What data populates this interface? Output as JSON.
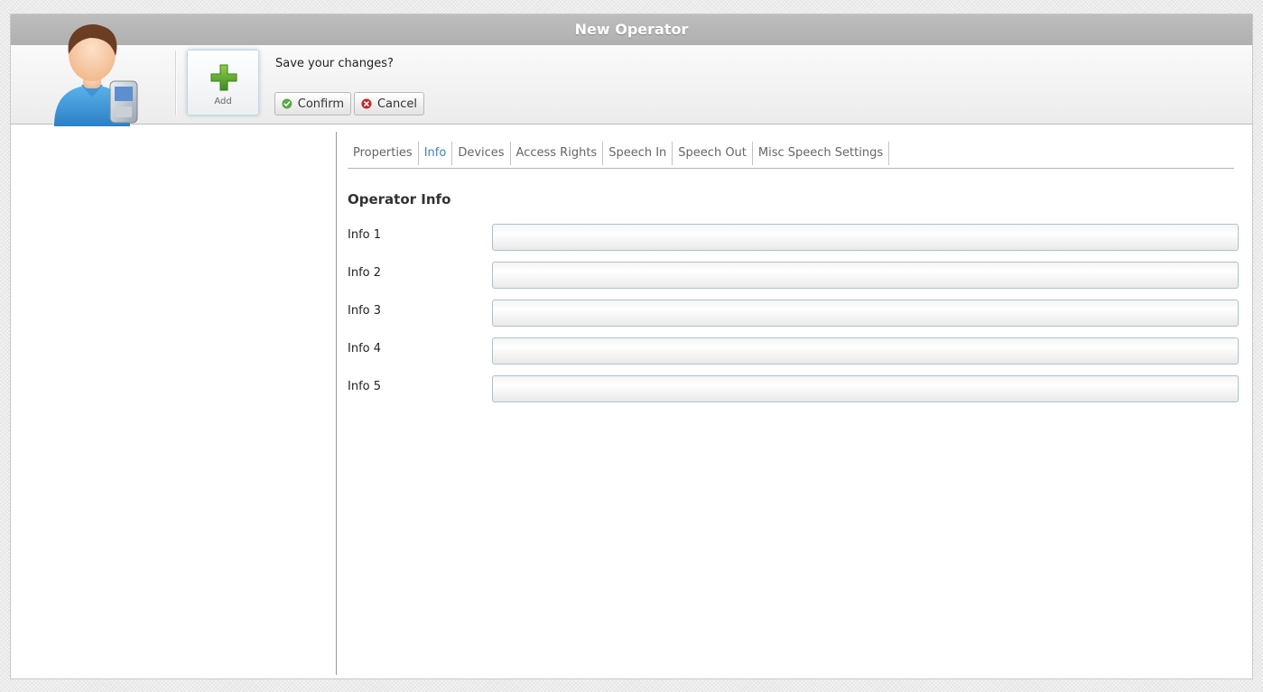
{
  "window": {
    "title": "New Operator"
  },
  "toolbar": {
    "add_label": "Add",
    "prompt": "Save your changes?",
    "confirm_label": "Confirm",
    "cancel_label": "Cancel",
    "confirm_icon": "check-icon",
    "cancel_icon": "x-icon"
  },
  "tabs": [
    {
      "label": "Properties",
      "active": false
    },
    {
      "label": "Info",
      "active": true
    },
    {
      "label": "Devices",
      "active": false
    },
    {
      "label": "Access Rights",
      "active": false
    },
    {
      "label": "Speech In",
      "active": false
    },
    {
      "label": "Speech Out",
      "active": false
    },
    {
      "label": "Misc Speech Settings",
      "active": false
    }
  ],
  "section": {
    "title": "Operator Info"
  },
  "fields": [
    {
      "label": "Info 1",
      "value": ""
    },
    {
      "label": "Info 2",
      "value": ""
    },
    {
      "label": "Info 3",
      "value": ""
    },
    {
      "label": "Info 4",
      "value": ""
    },
    {
      "label": "Info 5",
      "value": ""
    }
  ],
  "colors": {
    "active_tab": "#3b84b9",
    "titlebar": "#b5b5b5",
    "confirm": "#5aa845",
    "cancel": "#c0282d"
  }
}
